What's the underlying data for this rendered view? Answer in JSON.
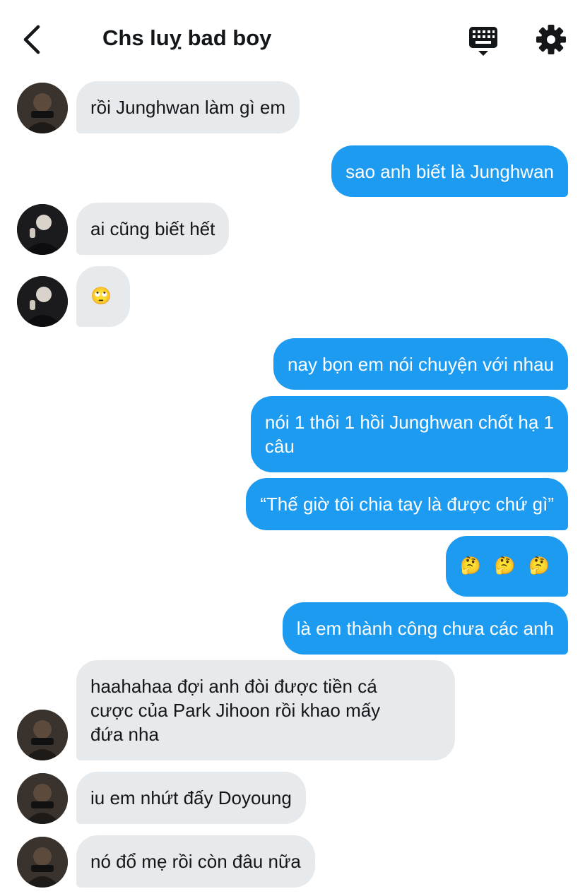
{
  "header": {
    "title": "Chs luỵ bad boy",
    "icons": {
      "back": "chevron-left-icon",
      "keyboard": "keyboard-icon",
      "settings": "gear-icon"
    }
  },
  "messages": [
    {
      "direction": "in",
      "lines": [
        "rồi Junghwan làm gì em"
      ]
    },
    {
      "direction": "out",
      "lines": [
        "sao anh biết là Junghwan"
      ]
    },
    {
      "direction": "in",
      "lines": [
        "ai cũng biết hết"
      ]
    },
    {
      "direction": "in",
      "lines": [
        "🙄"
      ]
    },
    {
      "direction": "out",
      "lines": [
        "nay bọn em nói chuyện với nhau"
      ]
    },
    {
      "direction": "out",
      "lines": [
        "nói 1 thôi 1 hồi Junghwan chốt hạ 1",
        "câu"
      ]
    },
    {
      "direction": "out",
      "lines": [
        "“Thế giờ tôi chia tay là được chứ gì”"
      ]
    },
    {
      "direction": "out",
      "lines": [
        "🤔 🤔 🤔"
      ]
    },
    {
      "direction": "out",
      "lines": [
        "là em thành công chưa các anh"
      ]
    },
    {
      "direction": "in",
      "lines": [
        "haahahaa đợi anh đòi được tiền cá",
        "cược của Park Jihoon rồi khao mấy",
        "đứa nha"
      ]
    },
    {
      "direction": "in",
      "lines": [
        "iu em nhứt đấy Doyoung"
      ]
    },
    {
      "direction": "in",
      "lines": [
        "nó đổ mẹ rồi còn đâu nữa"
      ]
    }
  ],
  "colors": {
    "incoming_bubble": "#e7eaed",
    "outgoing_bubble": "#1d9bf0",
    "outgoing_text": "#ffffff",
    "text": "#14171a"
  }
}
